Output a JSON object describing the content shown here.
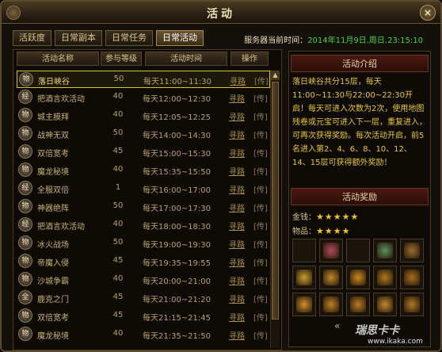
{
  "window": {
    "title": "活动",
    "close_label": "×"
  },
  "tabs": [
    {
      "label": "活跃度",
      "active": false
    },
    {
      "label": "日常副本",
      "active": false
    },
    {
      "label": "日常任务",
      "active": false
    },
    {
      "label": "日常活动",
      "active": true
    }
  ],
  "server_time": {
    "label": "服务器当前时间：",
    "value": "2014年11月9日.周日.23:15:10"
  },
  "table": {
    "headers": [
      "活动名称",
      "参与等级",
      "活动时间",
      "操作"
    ],
    "find_label": "寻路",
    "go_label": "[传]",
    "rows": [
      {
        "icon": "物",
        "name": "落日峡谷",
        "level": "50",
        "time": "每天11:00~11:30",
        "selected": true
      },
      {
        "icon": "经",
        "name": "把酒言欢活动",
        "level": "40",
        "time": "每天12:00~12:30",
        "selected": false
      },
      {
        "icon": "物",
        "name": "城主膜拜",
        "level": "40",
        "time": "每天12:05~12:25",
        "selected": false
      },
      {
        "icon": "物",
        "name": "战神无双",
        "level": "50",
        "time": "每天14:00~14:30",
        "selected": false
      },
      {
        "icon": "物",
        "name": "双倍宽考",
        "level": "45",
        "time": "每天15:00~15:30",
        "selected": false
      },
      {
        "icon": "物",
        "name": "魔龙秘境",
        "level": "40",
        "time": "每天15:35~15:50",
        "selected": false
      },
      {
        "icon": "经",
        "name": "全服双倍",
        "level": "1",
        "time": "每天16:00~17:00",
        "selected": false
      },
      {
        "icon": "物",
        "name": "神器绝阵",
        "level": "50",
        "time": "每天17:00~17:30",
        "selected": false
      },
      {
        "icon": "经",
        "name": "把酒言欢活动",
        "level": "40",
        "time": "每天18:00~18:30",
        "selected": false
      },
      {
        "icon": "物",
        "name": "冰火战场",
        "level": "50",
        "time": "每天19:00~19:30",
        "selected": false
      },
      {
        "icon": "物",
        "name": "帝魔入侵",
        "level": "45",
        "time": "每天19:35~19:55",
        "selected": false
      },
      {
        "icon": "物",
        "name": "沙城争霸",
        "level": "40",
        "time": "每天20:00~21:00",
        "selected": false
      },
      {
        "icon": "全",
        "name": "鹿克之门",
        "level": "45",
        "time": "每天21:00~21:20",
        "selected": false
      },
      {
        "icon": "物",
        "name": "双倍宽考",
        "level": "45",
        "time": "每天21:15~21:45",
        "selected": false
      },
      {
        "icon": "物",
        "name": "魔龙秘境",
        "level": "40",
        "time": "每天21:35~21:50",
        "selected": false
      }
    ]
  },
  "intro": {
    "title": "活动介绍",
    "text": "落日峡谷共分15层，每天11:00~11:30与22:00~22:30开启！每天可进入次数为2次，使用地图残卷或元宝可进入下一层，重复进入，可再次获得奖励。每次活动开启，前5名进入第2、4、6、8、10、12、14、15层可获得额外奖励！"
  },
  "reward": {
    "title": "活动奖励",
    "money_label": "金钱：",
    "money_stars": 5,
    "items_label": "物品：",
    "items_stars": 4,
    "star_glyph": "★"
  },
  "reward_slots": [
    {
      "icon": "empty-slot",
      "color": ""
    },
    {
      "icon": "seal-icon",
      "color": "#b04a60"
    },
    {
      "icon": "empty-slot",
      "color": ""
    },
    {
      "icon": "sword-icon",
      "color": "#5a9060"
    },
    {
      "icon": "armor-icon",
      "color": "#9a6a30"
    },
    {
      "icon": "helmet-icon",
      "color": "#c8a030"
    },
    {
      "icon": "armor-icon",
      "color": "#c08a28"
    },
    {
      "icon": "armor-icon",
      "color": "#c88a20"
    },
    {
      "icon": "armor-icon",
      "color": "#b07820"
    },
    {
      "icon": "armor-icon",
      "color": "#a87020"
    },
    {
      "icon": "ring-icon",
      "color": "#d09030"
    },
    {
      "icon": "necklace-icon",
      "color": "#c08028"
    },
    {
      "icon": "armor-icon",
      "color": "#b87a28"
    },
    {
      "icon": "armor-icon",
      "color": "#c08830"
    },
    {
      "icon": "boots-icon",
      "color": "#b07828"
    }
  ],
  "watermark": {
    "brand": "瑞思卡卡",
    "url": "www.ikaka.com",
    "arrows": "«"
  }
}
